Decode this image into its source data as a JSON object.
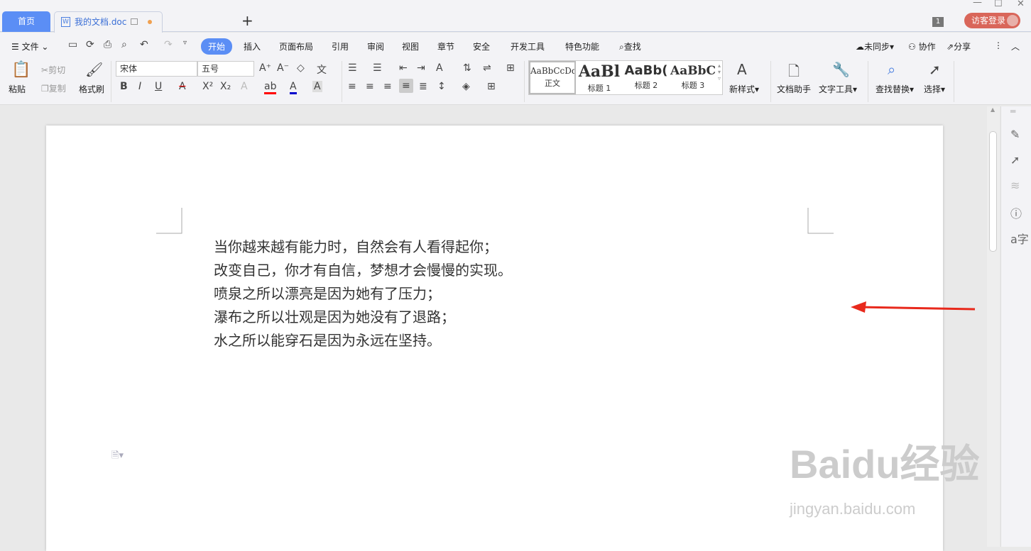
{
  "tabs": {
    "home": "首页",
    "doc": "我的文档.doc",
    "doc_icon": "W",
    "new": "+"
  },
  "window": {
    "badge": "1",
    "login": "访客登录",
    "min": "—",
    "max": "☐",
    "close": "✕"
  },
  "menu": {
    "file": "文件",
    "items": [
      "开始",
      "插入",
      "页面布局",
      "引用",
      "审阅",
      "视图",
      "章节",
      "安全",
      "开发工具",
      "特色功能"
    ],
    "find": "查找",
    "sync": "未同步",
    "collab": "协作",
    "share": "分享"
  },
  "ribbon": {
    "paste": "粘贴",
    "cut": "剪切",
    "copy": "复制",
    "format_painter": "格式刷",
    "font": "宋体",
    "size": "五号",
    "styles": [
      {
        "preview": "AaBbCcDd",
        "name": "正文"
      },
      {
        "preview": "AaBl",
        "name": "标题 1"
      },
      {
        "preview": "AaBb(",
        "name": "标题 2"
      },
      {
        "preview": "AaBbC",
        "name": "标题 3"
      }
    ],
    "new_style": "新样式",
    "doc_helper": "文档助手",
    "text_tools": "文字工具",
    "find_replace": "查找替换",
    "select": "选择"
  },
  "document": {
    "lines": [
      "当你越来越有能力时，自然会有人看得起你；",
      "改变自己，你才有自信，梦想才会慢慢的实现。",
      "喷泉之所以漂亮是因为她有了压力；",
      "瀑布之所以壮观是因为她没有了退路；",
      "水之所以能穿石是因为永远在坚持。"
    ]
  },
  "watermark": {
    "logo": "Baidu经验",
    "url": "jingyan.baidu.com"
  },
  "colors": {
    "accent": "#5b8ef5",
    "login": "#d9665a",
    "arrow": "#e8291c"
  }
}
